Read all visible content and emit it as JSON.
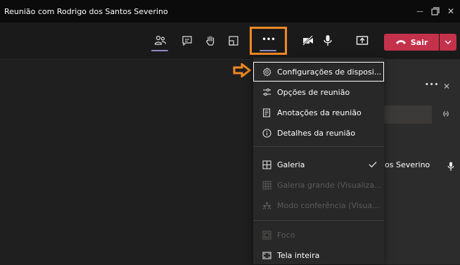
{
  "window": {
    "title": "Reunião com Rodrigo dos Santos Severino"
  },
  "window_controls": {
    "minimize": "—",
    "close": "✕"
  },
  "toolbar": {
    "leave_label": "Sair",
    "items": [
      {
        "icon": "participants-icon"
      },
      {
        "icon": "chat-icon"
      },
      {
        "icon": "raise-hand-icon"
      },
      {
        "icon": "rooms-icon"
      },
      {
        "icon": "more-actions-icon",
        "label": "•••"
      },
      {
        "icon": "camera-off-icon"
      },
      {
        "icon": "microphone-icon"
      },
      {
        "icon": "share-screen-icon"
      }
    ]
  },
  "more_menu": {
    "items": [
      {
        "label": "Configurações de disposi...",
        "icon": "gear-icon",
        "enabled": true
      },
      {
        "label": "Opções de reunião",
        "icon": "sliders-icon",
        "enabled": true
      },
      {
        "label": "Anotações da reunião",
        "icon": "notes-icon",
        "enabled": true
      },
      {
        "label": "Detalhes da reunião",
        "icon": "info-icon",
        "enabled": true
      },
      {
        "label": "Galeria",
        "icon": "gallery-icon",
        "enabled": true,
        "checked": true
      },
      {
        "label": "Galeria grande (Visualiza...",
        "icon": "large-gallery-icon",
        "enabled": false
      },
      {
        "label": "Modo conferência (Visua...",
        "icon": "together-mode-icon",
        "enabled": false
      },
      {
        "label": "Foco",
        "icon": "focus-icon",
        "enabled": false
      },
      {
        "label": "Tela inteira",
        "icon": "fullscreen-icon",
        "enabled": true
      }
    ]
  },
  "side_panel": {
    "more_label": "•••",
    "close_label": "✕",
    "participant_name": "os Severino"
  },
  "colors": {
    "accent": "#8b8cc7",
    "leave": "#c4314b",
    "annotation": "#f08a24"
  }
}
